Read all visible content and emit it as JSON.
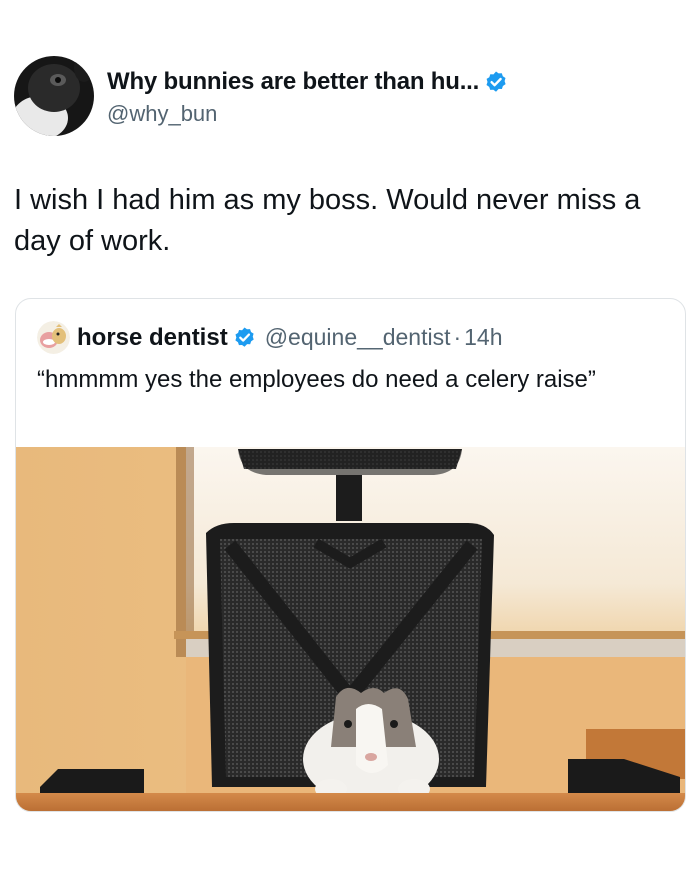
{
  "tweet": {
    "author": {
      "display_name": "Why bunnies are better than hu...",
      "handle": "@why_bun",
      "verified": true
    },
    "text": "I wish I had him as my boss. Would never miss a day of work."
  },
  "quote": {
    "author": {
      "display_name": "horse dentist",
      "handle": "@equine__dentist",
      "verified": true
    },
    "separator": "·",
    "timestamp": "14h",
    "text": "“hmmmm yes the employees do need a celery raise”"
  },
  "colors": {
    "verified_blue": "#1d9bf0",
    "text_primary": "#0f1419",
    "text_secondary": "#536471",
    "card_border": "#dfe3e6"
  }
}
